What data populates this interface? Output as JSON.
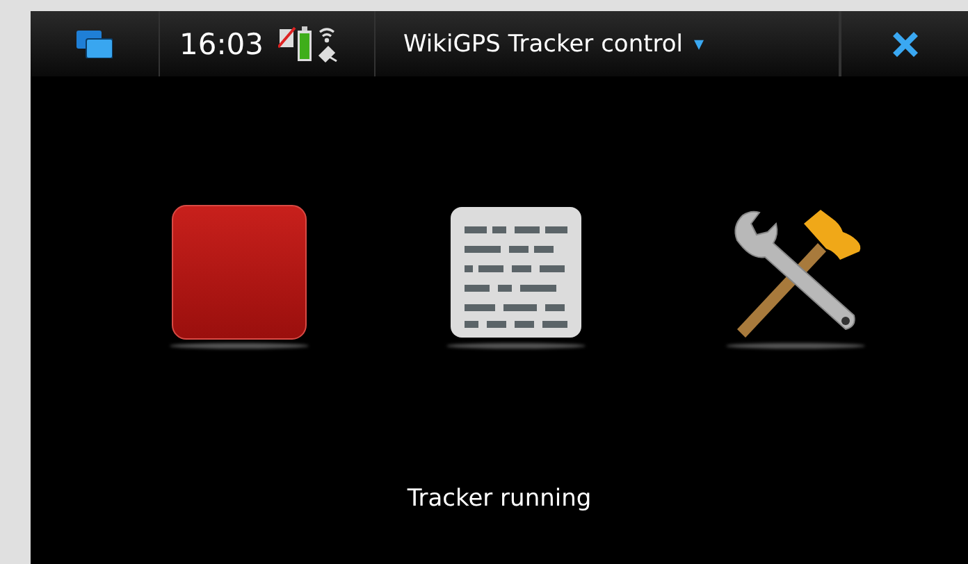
{
  "status_bar": {
    "time": "16:03",
    "title": "WikiGPS Tracker control",
    "title_menu": "▾"
  },
  "actions": [
    {
      "kind": "stop"
    },
    {
      "kind": "log"
    },
    {
      "kind": "settings"
    }
  ],
  "status_text": "Tracker running"
}
